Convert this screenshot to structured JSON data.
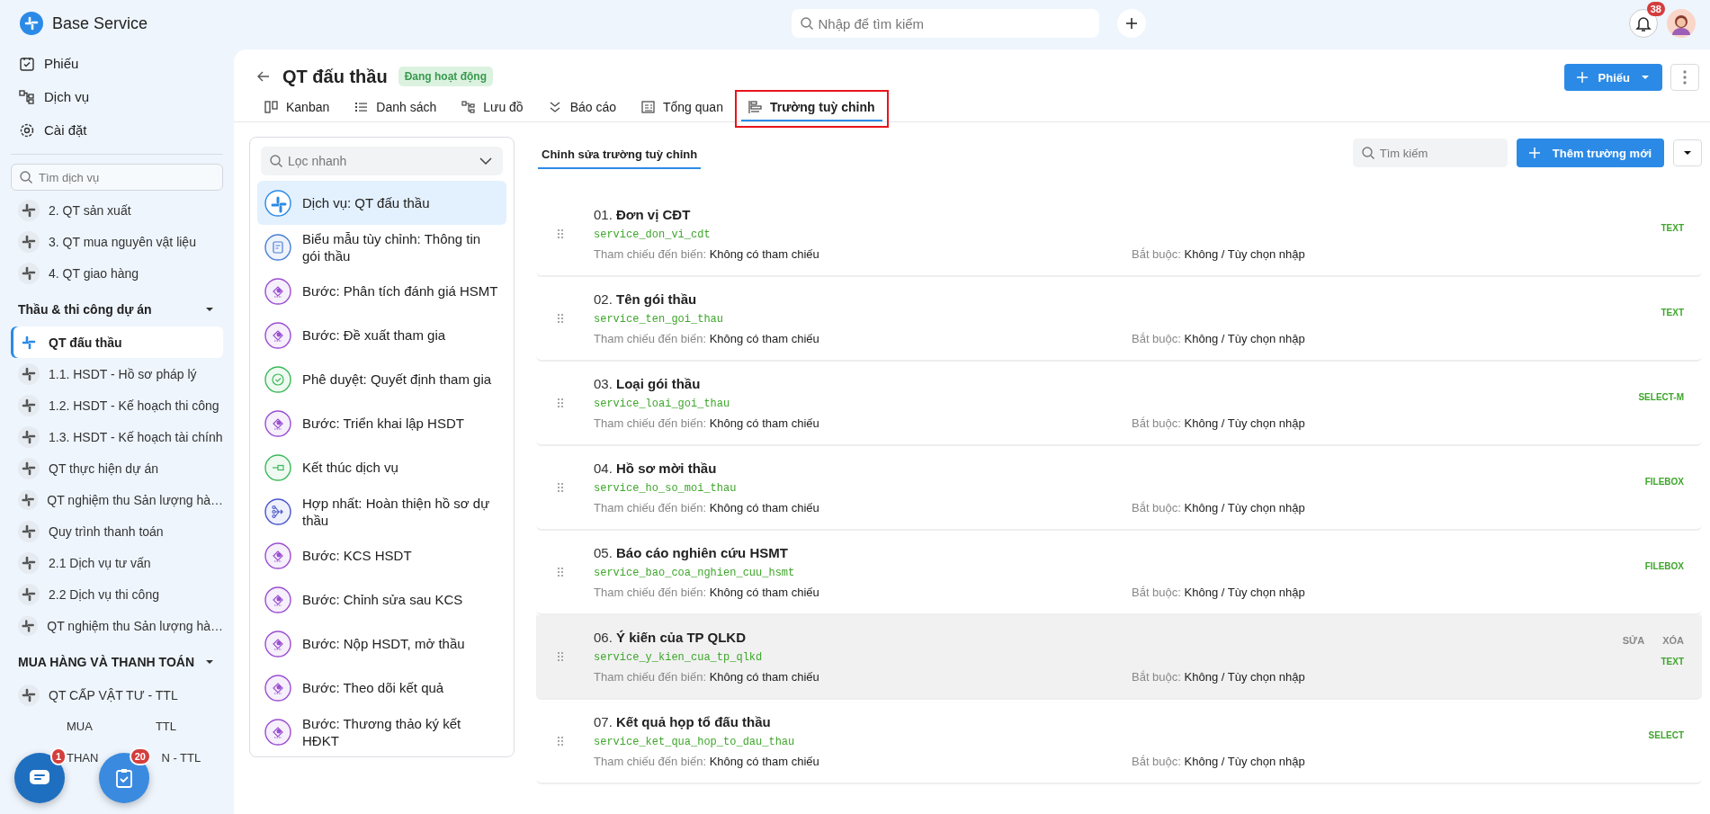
{
  "app": {
    "name": "Base Service"
  },
  "top_search": {
    "placeholder": "Nhập để tìm kiếm"
  },
  "notifications": {
    "count": "38"
  },
  "sidebar": {
    "nav": [
      {
        "kind": "tickets",
        "label": "Phiếu"
      },
      {
        "kind": "services",
        "label": "Dịch vụ"
      },
      {
        "kind": "settings",
        "label": "Cài đặt"
      }
    ],
    "search": {
      "placeholder": "Tìm dịch vụ"
    },
    "groups": [
      {
        "items": [
          {
            "label": "2. QT sản xuất",
            "selected": false
          },
          {
            "label": "3. QT mua nguyên vật liệu",
            "selected": false
          },
          {
            "label": "4. QT giao hàng",
            "selected": false
          }
        ]
      },
      {
        "title": "Thầu & thi công dự án",
        "expanded": true,
        "items": [
          {
            "label": "QT đấu thầu",
            "selected": true
          },
          {
            "label": "1.1. HSDT - Hồ sơ pháp lý",
            "selected": false
          },
          {
            "label": "1.2. HSDT - Kế hoạch thi công",
            "selected": false
          },
          {
            "label": "1.3. HSDT - Kế hoạch tài chính",
            "selected": false
          },
          {
            "label": "QT thực hiện dự án",
            "selected": false
          },
          {
            "label": "QT nghiệm thu Sản lượng hà…",
            "selected": false
          },
          {
            "label": "Quy trình thanh toán",
            "selected": false
          },
          {
            "label": "2.1 Dịch vụ tư vấn",
            "selected": false
          },
          {
            "label": "2.2 Dịch vụ thi công",
            "selected": false
          },
          {
            "label": "QT nghiệm thu Sản lượng hà…",
            "selected": false
          }
        ]
      },
      {
        "title": "MUA HÀNG VÀ THANH TOÁN",
        "expanded": true,
        "items": [
          {
            "label": "QT CẤP VẬT TƯ - TTL",
            "selected": false
          },
          {
            "kind": "covered",
            "fragments": [
              "MUA",
              "TTL"
            ]
          },
          {
            "kind": "covered",
            "fragments": [
              "THAN",
              "N - TTL"
            ]
          }
        ]
      }
    ]
  },
  "page": {
    "title": "QT đấu thầu",
    "status": "Đang hoạt động",
    "add_button": "Phiếu",
    "tabs": [
      {
        "kind": "kanban",
        "label": "Kanban",
        "selected": false
      },
      {
        "kind": "list",
        "label": "Danh sách",
        "selected": false
      },
      {
        "kind": "flow",
        "label": "Lưu đồ",
        "selected": false
      },
      {
        "kind": "report",
        "label": "Báo cáo",
        "selected": false
      },
      {
        "kind": "overview",
        "label": "Tổng quan",
        "selected": false
      },
      {
        "kind": "fields",
        "label": "Trường tuỳ chỉnh",
        "selected": true,
        "highlighted": true
      }
    ]
  },
  "steps_panel": {
    "filter_placeholder": "Lọc nhanh",
    "items": [
      {
        "kind": "service",
        "label": "Dịch vụ: QT đấu thầu",
        "selected": true
      },
      {
        "kind": "form",
        "label": "Biểu mẫu tùy chỉnh: Thông tin gói thầu",
        "selected": false
      },
      {
        "kind": "step",
        "label": "Bước: Phân tích đánh giá HSMT",
        "selected": false
      },
      {
        "kind": "step",
        "label": "Bước: Đề xuất tham gia",
        "selected": false
      },
      {
        "kind": "approval",
        "label": "Phê duyệt: Quyết định tham gia",
        "selected": false
      },
      {
        "kind": "step",
        "label": "Bước: Triển khai lập HSDT",
        "selected": false
      },
      {
        "kind": "end",
        "label": "Kết thúc dịch vụ",
        "selected": false
      },
      {
        "kind": "merge",
        "label": "Hợp nhất: Hoàn thiện hồ sơ dự thầu",
        "selected": false
      },
      {
        "kind": "step",
        "label": "Bước: KCS HSDT",
        "selected": false
      },
      {
        "kind": "step",
        "label": "Bước: Chỉnh sửa sau KCS",
        "selected": false
      },
      {
        "kind": "step",
        "label": "Bước: Nộp HSDT, mở thầu",
        "selected": false
      },
      {
        "kind": "step",
        "label": "Bước: Theo dõi kết quả",
        "selected": false
      },
      {
        "kind": "step",
        "label": "Bước: Thương thảo ký kết HĐKT",
        "selected": false
      }
    ]
  },
  "fields_panel": {
    "tab": {
      "label": "Chỉnh sửa trường tuỳ chỉnh",
      "selected": true
    },
    "search_placeholder": "Tìm kiếm",
    "add_button": "Thêm trường mới",
    "fields": [
      {
        "number": "01.",
        "name": "Đơn vị CĐT",
        "code": "service_don_vi_cdt",
        "ref_label": "Tham chiếu đến biến:",
        "ref_value": "Không có tham chiếu",
        "required_label": "Bắt buộc:",
        "required_value": "Không / Tùy chọn nhập",
        "type": "TEXT",
        "hovered": false
      },
      {
        "number": "02.",
        "name": "Tên gói thầu",
        "code": "service_ten_goi_thau",
        "ref_label": "Tham chiếu đến biến:",
        "ref_value": "Không có tham chiếu",
        "required_label": "Bắt buộc:",
        "required_value": "Không / Tùy chọn nhập",
        "type": "TEXT",
        "hovered": false
      },
      {
        "number": "03.",
        "name": "Loại gói thầu",
        "code": "service_loai_goi_thau",
        "ref_label": "Tham chiếu đến biến:",
        "ref_value": "Không có tham chiếu",
        "required_label": "Bắt buộc:",
        "required_value": "Không / Tùy chọn nhập",
        "type": "SELECT-M",
        "hovered": false
      },
      {
        "number": "04.",
        "name": "Hồ sơ mời thầu",
        "code": "service_ho_so_moi_thau",
        "ref_label": "Tham chiếu đến biến:",
        "ref_value": "Không có tham chiếu",
        "required_label": "Bắt buộc:",
        "required_value": "Không / Tùy chọn nhập",
        "type": "FILEBOX",
        "hovered": false
      },
      {
        "number": "05.",
        "name": "Báo cáo nghiên cứu HSMT",
        "code": "service_bao_coa_nghien_cuu_hsmt",
        "ref_label": "Tham chiếu đến biến:",
        "ref_value": "Không có tham chiếu",
        "required_label": "Bắt buộc:",
        "required_value": "Không / Tùy chọn nhập",
        "type": "FILEBOX",
        "hovered": false
      },
      {
        "number": "06.",
        "name": "Ý kiến của TP QLKD",
        "code": "service_y_kien_cua_tp_qlkd",
        "ref_label": "Tham chiếu đến biến:",
        "ref_value": "Không có tham chiếu",
        "required_label": "Bắt buộc:",
        "required_value": "Không / Tùy chọn nhập",
        "type": "TEXT",
        "hovered": true,
        "actions": [
          "SỬA",
          "XÓA"
        ]
      },
      {
        "number": "07.",
        "name": "Kết quả họp tổ đấu thầu",
        "code": "service_ket_qua_hop_to_dau_thau",
        "ref_label": "Tham chiếu đến biến:",
        "ref_value": "Không có tham chiếu",
        "required_label": "Bắt buộc:",
        "required_value": "Không / Tùy chọn nhập",
        "type": "SELECT",
        "hovered": false
      }
    ]
  },
  "floating": {
    "chat_badge": "1",
    "tasks_badge": "20"
  }
}
